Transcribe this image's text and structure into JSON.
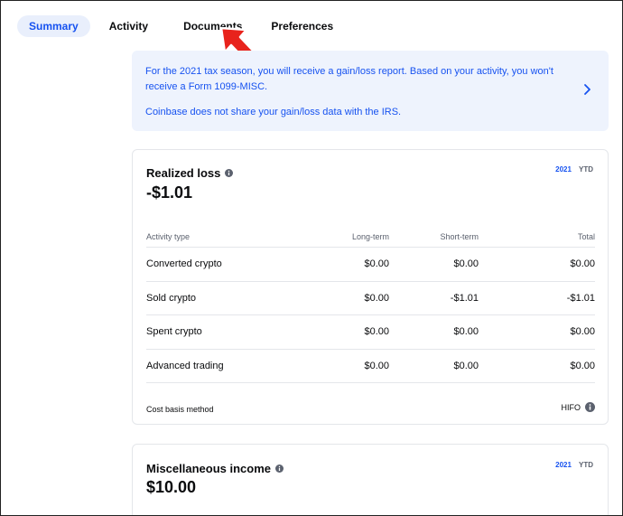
{
  "tabs": [
    {
      "label": "Summary",
      "active": true
    },
    {
      "label": "Activity",
      "active": false
    },
    {
      "label": "Documents",
      "active": false
    },
    {
      "label": "Preferences",
      "active": false
    }
  ],
  "banner": {
    "line1": "For the 2021 tax season, you will receive a gain/loss report. Based on your activity, you won't receive a Form 1099-MISC.",
    "line2": "Coinbase does not share your gain/loss data with the IRS.",
    "icon": "chevron-right-icon"
  },
  "realized_loss": {
    "title": "Realized loss",
    "amount": "-$1.01",
    "year": "2021",
    "period": "YTD",
    "columns": [
      "Activity type",
      "Long-term",
      "Short-term",
      "Total"
    ],
    "rows": [
      {
        "type": "Converted crypto",
        "long_term": "$0.00",
        "short_term": "$0.00",
        "total": "$0.00"
      },
      {
        "type": "Sold crypto",
        "long_term": "$0.00",
        "short_term": "-$1.01",
        "total": "-$1.01"
      },
      {
        "type": "Spent crypto",
        "long_term": "$0.00",
        "short_term": "$0.00",
        "total": "$0.00"
      },
      {
        "type": "Advanced trading",
        "long_term": "$0.00",
        "short_term": "$0.00",
        "total": "$0.00"
      }
    ],
    "cost_basis_label": "Cost basis method",
    "cost_basis_value": "HIFO"
  },
  "misc_income": {
    "title": "Miscellaneous income",
    "amount": "$10.00",
    "year": "2021",
    "period": "YTD"
  },
  "colors": {
    "accent": "#1652f0",
    "banner_bg": "#eef3fd",
    "pointer": "#e8231c"
  }
}
